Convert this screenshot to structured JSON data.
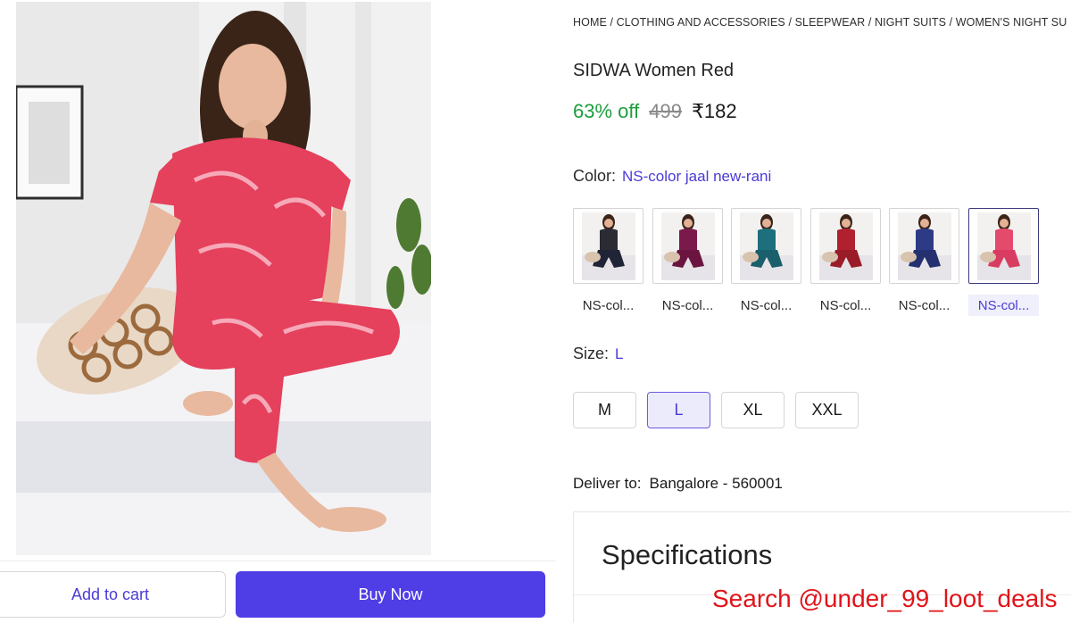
{
  "breadcrumb": {
    "home": "HOME",
    "sep": " / ",
    "level1": "CLOTHING AND ACCESSORIES",
    "level2": "SLEEPWEAR",
    "level3": "NIGHT SUITS",
    "level4": "WOMEN'S NIGHT SU"
  },
  "product": {
    "title": "SIDWA Women Red",
    "discount": "63% off",
    "mrp": "499",
    "price": "₹182"
  },
  "color": {
    "label": "Color:",
    "selected": "NS-color jaal new-rani",
    "options": [
      {
        "label": "NS-col...",
        "top": "#2b2b33",
        "bottom": "#1f2436"
      },
      {
        "label": "NS-col...",
        "top": "#7a1a4a",
        "bottom": "#6b1440"
      },
      {
        "label": "NS-col...",
        "top": "#1d6f7c",
        "bottom": "#1a5f6c"
      },
      {
        "label": "NS-col...",
        "top": "#b0202e",
        "bottom": "#9a1c28"
      },
      {
        "label": "NS-col...",
        "top": "#2d3b86",
        "bottom": "#24306f"
      },
      {
        "label": "NS-col...",
        "top": "#e34a6c",
        "bottom": "#d83d61"
      }
    ]
  },
  "size": {
    "label": "Size:",
    "selected": "L",
    "options": [
      "M",
      "L",
      "XL",
      "XXL"
    ]
  },
  "delivery": {
    "label": "Deliver to:",
    "location": "Bangalore - 560001"
  },
  "specifications": {
    "heading": "Specifications"
  },
  "actions": {
    "add_to_cart": "Add to cart",
    "buy_now": "Buy Now"
  },
  "overlay": {
    "watermark": "Search @under_99_loot_deals"
  },
  "colors": {
    "accent": "#4f3de6",
    "discount": "#1e9e3e",
    "watermark": "#e0141a"
  }
}
